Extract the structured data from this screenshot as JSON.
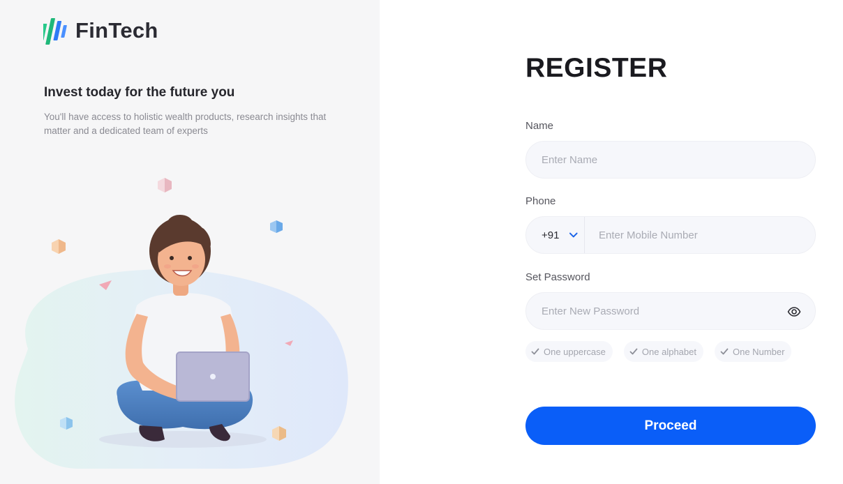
{
  "brand": {
    "name": "FinTech"
  },
  "hero": {
    "tagline": "Invest today for the future you",
    "description": "You'll have access to holistic wealth products, research insights that matter and a dedicated team of experts"
  },
  "form": {
    "title": "REGISTER",
    "name": {
      "label": "Name",
      "placeholder": "Enter Name"
    },
    "phone": {
      "label": "Phone",
      "country_code": "+91",
      "placeholder": "Enter Mobile Number"
    },
    "password": {
      "label": "Set Password",
      "placeholder": "Enter New Password"
    },
    "hints": [
      "One uppercase",
      "One alphabet",
      "One Number"
    ],
    "submit_label": "Proceed"
  },
  "colors": {
    "accent": "#0a5ef8",
    "logo_green": "#27c98a",
    "logo_blue": "#2f7bf5"
  },
  "icons": {
    "password_toggle": "eye-icon",
    "phone_dropdown": "chevron-down-icon",
    "hint_check": "check-icon"
  }
}
